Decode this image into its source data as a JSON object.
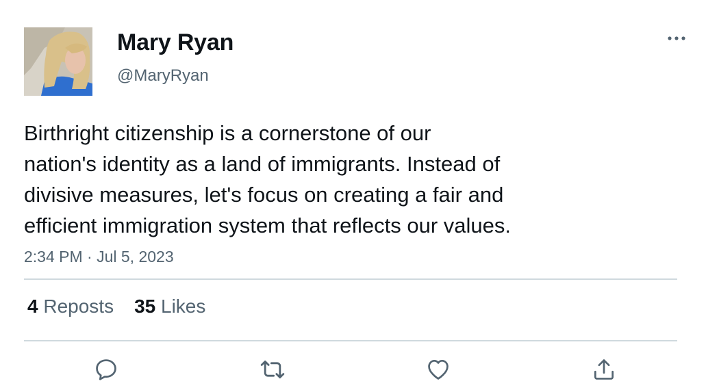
{
  "author": {
    "display_name": "Mary Ryan",
    "handle": "@MaryRyan"
  },
  "tweet": {
    "text_lines": [
      "Birthright citizenship is a cornerstone of our",
      "nation's identity as a land of immigrants. Instead of",
      "divisive measures, let's focus on creating a fair and",
      "efficient immigration system that reflects our values."
    ],
    "timestamp": "2:34 PM · Jul 5, 2023"
  },
  "stats": {
    "reposts_count": "4",
    "reposts_label": "Reposts",
    "likes_count": "35",
    "likes_label": "Likes"
  },
  "icons": {
    "more": "more-dots-icon",
    "reply": "reply-icon",
    "repost": "repost-icon",
    "like": "heart-icon",
    "share": "share-icon"
  },
  "colors": {
    "text": "#0f1419",
    "secondary": "#536471",
    "divider": "#cfd9de"
  }
}
